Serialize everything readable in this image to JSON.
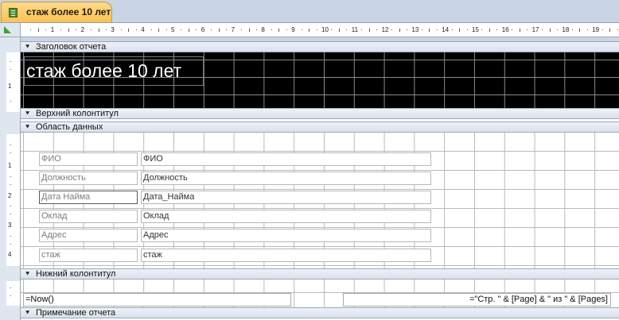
{
  "document_tab": {
    "title": "стаж более 10 лет"
  },
  "ruler": {
    "horizontal": [
      "1",
      "2",
      "3",
      "4",
      "5",
      "6",
      "7",
      "8",
      "9",
      "10",
      "11",
      "12",
      "13",
      "14",
      "15",
      "16",
      "17",
      "18",
      "19"
    ],
    "vertical": [
      "1",
      "1",
      "2",
      "3",
      "4"
    ]
  },
  "sections": {
    "report_header": "Заголовок отчета",
    "page_header": "Верхний колонтитул",
    "detail": "Область данных",
    "page_footer": "Нижний колонтитул",
    "report_footer": "Примечание отчета"
  },
  "report_title": "стаж более 10 лет",
  "fields": [
    {
      "label": "ФИО",
      "control": "ФИО"
    },
    {
      "label": "Должность",
      "control": "Должность"
    },
    {
      "label": "Дата Найма",
      "control": "Дата_Найма"
    },
    {
      "label": "Оклад",
      "control": "Оклад"
    },
    {
      "label": "Адрес",
      "control": "Адрес"
    },
    {
      "label": "стаж",
      "control": "стаж"
    }
  ],
  "footer": {
    "date_expr": "=Now()",
    "page_expr": "=\"Стр. \" & [Page] & \" из \" & [Pages]"
  },
  "colors": {
    "tab": "#ffc24d",
    "band": "#d9e1ec",
    "ruler_mark": "#2fae1f"
  }
}
